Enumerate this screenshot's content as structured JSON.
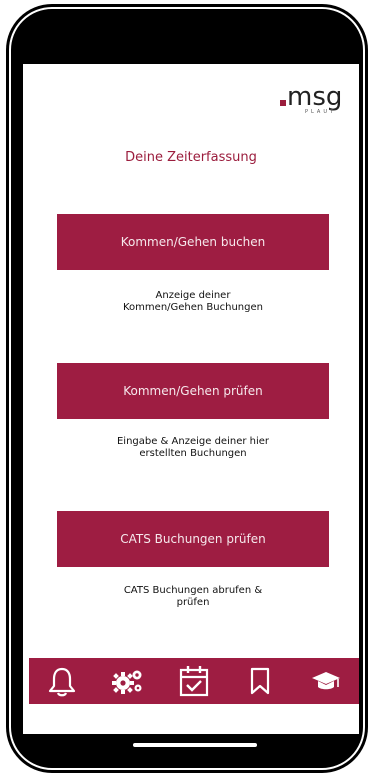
{
  "logo": {
    "text": "msg",
    "sub": "PLAUT"
  },
  "title": "Deine Zeiterfassung",
  "actions": [
    {
      "label": "Kommen/Gehen buchen",
      "description": "Anzeige deiner\nKommen/Gehen Buchungen"
    },
    {
      "label": "Kommen/Gehen prüfen",
      "description": "Eingabe & Anzeige deiner hier\nerstellten Buchungen"
    },
    {
      "label": "CATS Buchungen prüfen",
      "description": "CATS Buchungen abrufen &\nprüfen"
    }
  ],
  "tabbar": {
    "items": [
      {
        "icon": "bell-icon"
      },
      {
        "icon": "gears-icon"
      },
      {
        "icon": "calendar-check-icon"
      },
      {
        "icon": "bookmark-icon"
      },
      {
        "icon": "graduation-cap-icon"
      }
    ]
  },
  "colors": {
    "brand": "#9e1d42",
    "title": "#9b1d3d"
  }
}
